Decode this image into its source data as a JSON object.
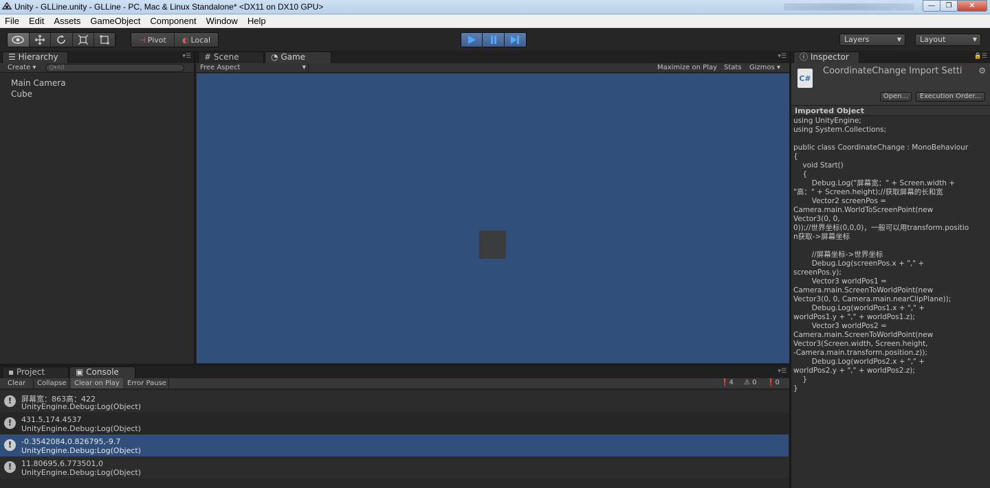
{
  "window": {
    "title": "Unity - GLLine.unity - GLLine - PC, Mac & Linux Standalone* <DX11 on DX10 GPU>",
    "controls": [
      "—",
      "❐",
      "✕"
    ]
  },
  "menu": [
    "File",
    "Edit",
    "Assets",
    "GameObject",
    "Component",
    "Window",
    "Help"
  ],
  "toolbar": {
    "pivot_label": "Pivot",
    "local_label": "Local",
    "layers_label": "Layers",
    "layout_label": "Layout"
  },
  "hierarchy": {
    "tab": "Hierarchy",
    "create_label": "Create ▾",
    "search_placeholder": "Q▾All",
    "items": [
      "Main Camera",
      "Cube"
    ]
  },
  "center": {
    "tabs": [
      "Scene",
      "Game"
    ],
    "aspect": "Free Aspect",
    "maximize": "Maximize on Play",
    "stats": "Stats",
    "gizmos": "Gizmos ▾"
  },
  "inspector": {
    "tab": "Inspector",
    "title": "CoordinateChange Import Setti",
    "open_btn": "Open...",
    "exec_btn": "Execution Order...",
    "section": "Imported Object",
    "code": [
      "using UnityEngine;",
      "using System.Collections;",
      "",
      "public class CoordinateChange : MonoBehaviour",
      "{",
      "    void Start()",
      "    {",
      "        Debug.Log(\"屏幕宽：\" + Screen.width +",
      "\"高：\" + Screen.height);//获取屏幕的长和宽",
      "        Vector2 screenPos =",
      "Camera.main.WorldToScreenPoint(new",
      "Vector3(0, 0,",
      "0));//世界坐标(0,0,0)，一般可以用transform.positio",
      "n获取->屏幕坐标",
      "",
      "        //屏幕坐标->世界坐标",
      "        Debug.Log(screenPos.x + \",\" +",
      "screenPos.y);",
      "        Vector3 worldPos1 =",
      "Camera.main.ScreenToWorldPoint(new",
      "Vector3(0, 0, Camera.main.nearClipPlane));",
      "        Debug.Log(worldPos1.x + \",\" +",
      "worldPos1.y + \",\" + worldPos1.z);",
      "        Vector3 worldPos2 =",
      "Camera.main.ScreenToWorldPoint(new",
      "Vector3(Screen.width, Screen.height,",
      "-Camera.main.transform.position.z));",
      "        Debug.Log(worldPos2.x + \",\" +",
      "worldPos2.y + \",\" + worldPos2.z);",
      "    }",
      "}"
    ]
  },
  "bottom": {
    "tabs": [
      "Project",
      "Console"
    ],
    "buttons": [
      "Clear",
      "Collapse",
      "Clear on Play",
      "Error Pause"
    ],
    "counts": {
      "log": "4",
      "warn": "0",
      "error": "0"
    },
    "entries": [
      {
        "msg": "屏幕宽：863高：422",
        "src": "UnityEngine.Debug:Log(Object)"
      },
      {
        "msg": "431.5,174.4537",
        "src": "UnityEngine.Debug:Log(Object)"
      },
      {
        "msg": "-0.3542084,0.826795,-9.7",
        "src": "UnityEngine.Debug:Log(Object)"
      },
      {
        "msg": "11.80695,6.773501,0",
        "src": "UnityEngine.Debug:Log(Object)"
      }
    ]
  }
}
